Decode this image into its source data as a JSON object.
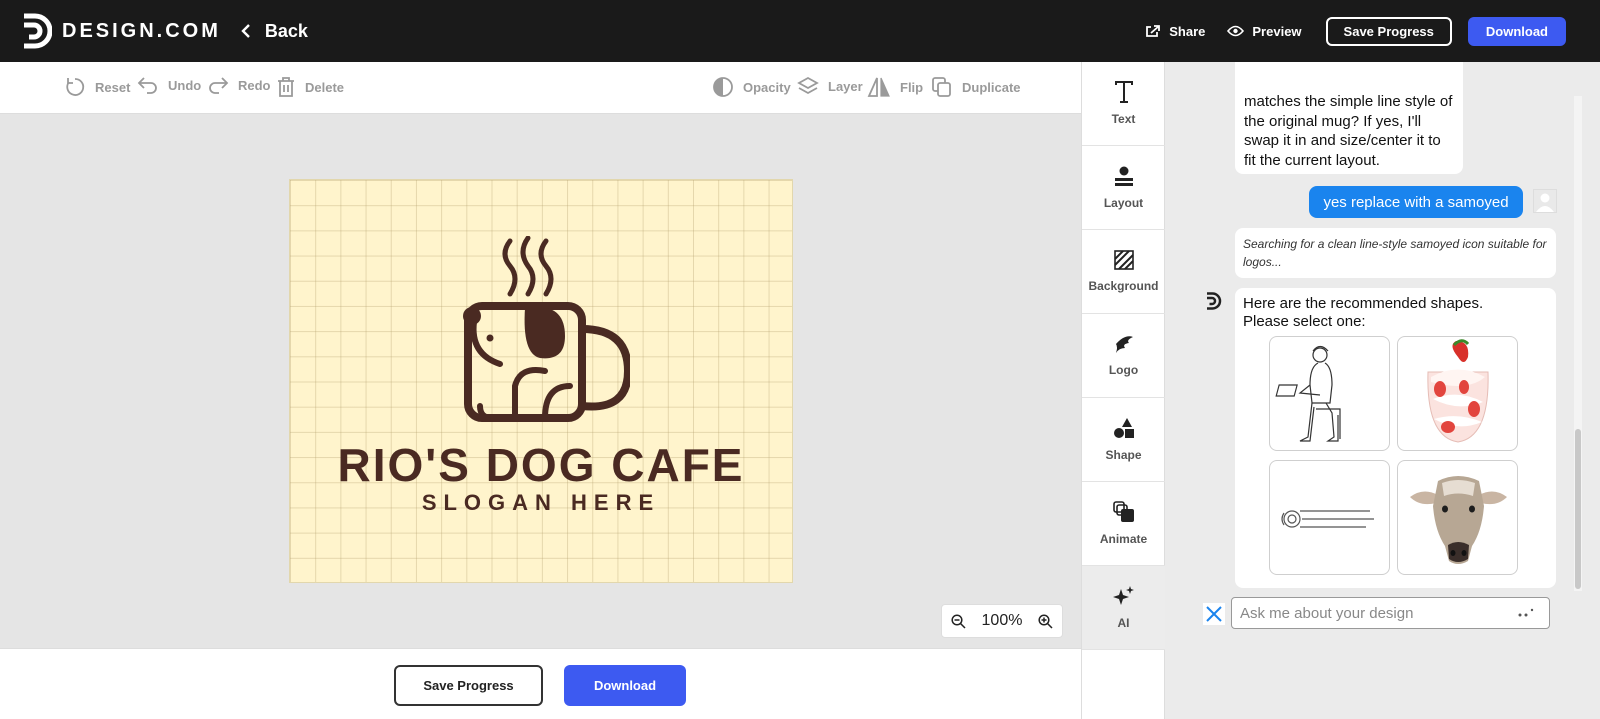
{
  "header": {
    "brand": "DESIGN.COM",
    "back_label": "Back",
    "share_label": "Share",
    "preview_label": "Preview",
    "save_label": "Save Progress",
    "download_label": "Download"
  },
  "toolbar": {
    "reset": "Reset",
    "undo": "Undo",
    "redo": "Redo",
    "delete": "Delete",
    "opacity": "Opacity",
    "layer": "Layer",
    "flip": "Flip",
    "duplicate": "Duplicate"
  },
  "canvas": {
    "title": "RIO'S DOG CAFE",
    "slogan": "SLOGAN HERE",
    "background_color": "#fff4cc",
    "logo_color": "#4a2a22"
  },
  "zoom": {
    "value": "100%"
  },
  "bottom": {
    "save_label": "Save Progress",
    "download_label": "Download"
  },
  "rail": {
    "items": [
      {
        "label": "Text",
        "icon": "text-icon"
      },
      {
        "label": "Layout",
        "icon": "layout-icon"
      },
      {
        "label": "Background",
        "icon": "background-icon"
      },
      {
        "label": "Logo",
        "icon": "logo-icon"
      },
      {
        "label": "Shape",
        "icon": "shape-icon"
      },
      {
        "label": "Animate",
        "icon": "animate-icon"
      },
      {
        "label": "AI",
        "icon": "ai-sparkle-icon"
      }
    ]
  },
  "chat": {
    "assistant_message_1": "matches the simple line style of the original mug? If yes, I'll swap it in and size/center it to fit the current layout.",
    "user_message": "yes replace with a samoyed",
    "assistant_status": "Searching for a clean line-style samoyed icon suitable for logos...",
    "assistant_message_2": "Here are the recommended shapes. Please select one:",
    "shapes": [
      "man-with-laptop-illustration",
      "strawberry-parfait-illustration",
      "speeding-ball-line-illustration",
      "cow-head-illustration"
    ],
    "input_placeholder": "Ask me about your design",
    "accent_color": "#1a84ee"
  }
}
